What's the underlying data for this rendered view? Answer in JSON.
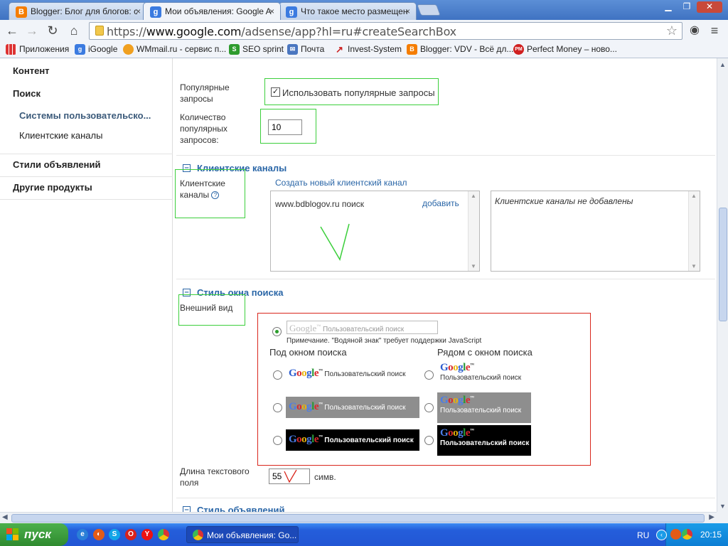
{
  "browser": {
    "tabs": [
      {
        "title": "Blogger: Блог для блогов: с",
        "favicon": "blogger-icon",
        "active": false
      },
      {
        "title": "Мои объявления: Google Ad",
        "favicon": "google-icon",
        "active": true
      },
      {
        "title": "Что такое место размещен",
        "favicon": "google-icon",
        "active": false
      }
    ],
    "close_glyph": "×",
    "url_prefix": "https://",
    "url_host": "www.google.com",
    "url_path": "/adsense/app?hl=ru#createSearchBox",
    "bookmarks": [
      {
        "label": "Приложения"
      },
      {
        "label": "iGoogle"
      },
      {
        "label": "WMmail.ru - сервис п..."
      },
      {
        "label": "SEO sprint"
      },
      {
        "label": "Почта"
      },
      {
        "label": "Invest-System"
      },
      {
        "label": "Blogger: VDV - Всё дл..."
      },
      {
        "label": "Perfect Money – ново..."
      }
    ]
  },
  "sidebar": {
    "content": "Контент",
    "search": "Поиск",
    "custom_search": "Системы пользовательско...",
    "client_channels": "Клиентские каналы",
    "ad_styles": "Стили объявлений",
    "other_products": "Другие продукты"
  },
  "form": {
    "popular_label": "Популярные запросы",
    "popular_checkbox": "Использовать популярные запросы",
    "popular_count_label": "Количество популярных запросов:",
    "popular_count_value": "10",
    "channels_section": "Клиентские каналы",
    "channels_label": "Клиентские каналы",
    "create_channel_link": "Создать новый клиентский канал",
    "channel_item": "www.bdblogov.ru поиск",
    "add_link": "добавить",
    "no_channels": "Клиентские каналы не добавлены",
    "search_style_section": "Стиль окна поиска",
    "appearance_label": "Внешний вид",
    "watermark_text": "Пользовательский поиск",
    "watermark_note": "Примечание. \"Водяной знак\" требует поддержки JavaScript",
    "below_label": "Под окном поиска",
    "beside_label": "Рядом с окном поиска",
    "sample_text": "Пользовательский поиск",
    "field_length_label": "Длина текстового поля",
    "field_length_value": "55",
    "field_length_unit": "симв.",
    "ad_styles_section": "Стиль объявлений"
  },
  "taskbar": {
    "start": "пуск",
    "task_item": "Мои объявления: Go...",
    "lang": "RU",
    "clock": "20:15"
  },
  "colors": {
    "annotation_green": "#3ccf3c",
    "annotation_red": "#d9261c",
    "link_blue": "#2a66a7"
  }
}
